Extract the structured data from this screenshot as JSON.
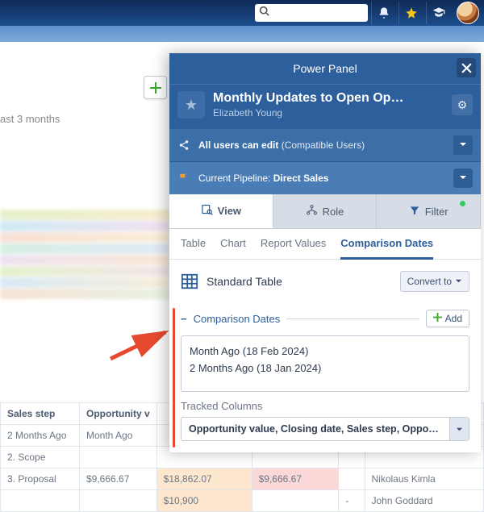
{
  "topbar": {
    "icons": [
      "bell-icon",
      "star-icon",
      "graduation-cap-icon",
      "avatar"
    ]
  },
  "bg": {
    "partial_button_label": "",
    "hint_text": "ast 3 months",
    "table": {
      "headers": [
        "Sales step",
        "Opportunity v",
        "",
        "",
        "",
        ""
      ],
      "subheaders": [
        "2 Months Ago",
        "Month Ago",
        "",
        "",
        "",
        ""
      ],
      "rows": [
        {
          "step": "2. Scope",
          "v": "",
          "c1": "",
          "c2": "",
          "c3": "",
          "name": ""
        },
        {
          "step": "3. Proposal",
          "v": "$9,666.67",
          "c1": "$18,862.07",
          "c2": "$9,666.67",
          "c3": "",
          "name": "Nikolaus Kimla"
        },
        {
          "step": "",
          "v": "",
          "c1": "$10,900",
          "c2": "",
          "c3": "-",
          "name": "John Goddard"
        }
      ]
    }
  },
  "panel": {
    "header": "Power Panel",
    "title": "Monthly Updates to Open Op…",
    "owner": "Elizabeth Young",
    "share": {
      "label_bold": "All users can edit",
      "label_paren": "(Compatible Users)"
    },
    "pipeline": {
      "prefix": "Current Pipeline:",
      "value": "Direct Sales"
    },
    "tabs1": [
      {
        "label": "View",
        "icon": "view"
      },
      {
        "label": "Role",
        "icon": "role"
      },
      {
        "label": "Filter",
        "icon": "filter",
        "badge": true
      }
    ],
    "tabs2": [
      "Table",
      "Chart",
      "Report Values",
      "Comparison Dates"
    ],
    "std_label": "Standard Table",
    "convert_label": "Convert to",
    "section_title": "Comparison Dates",
    "add_label": "Add",
    "dates": [
      "Month Ago (18 Feb 2024)",
      "2 Months Ago (18 Jan 2024)"
    ],
    "tracked_label": "Tracked Columns",
    "tracked_value": "Opportunity value, Closing date, Sales step, Opportuni…"
  }
}
